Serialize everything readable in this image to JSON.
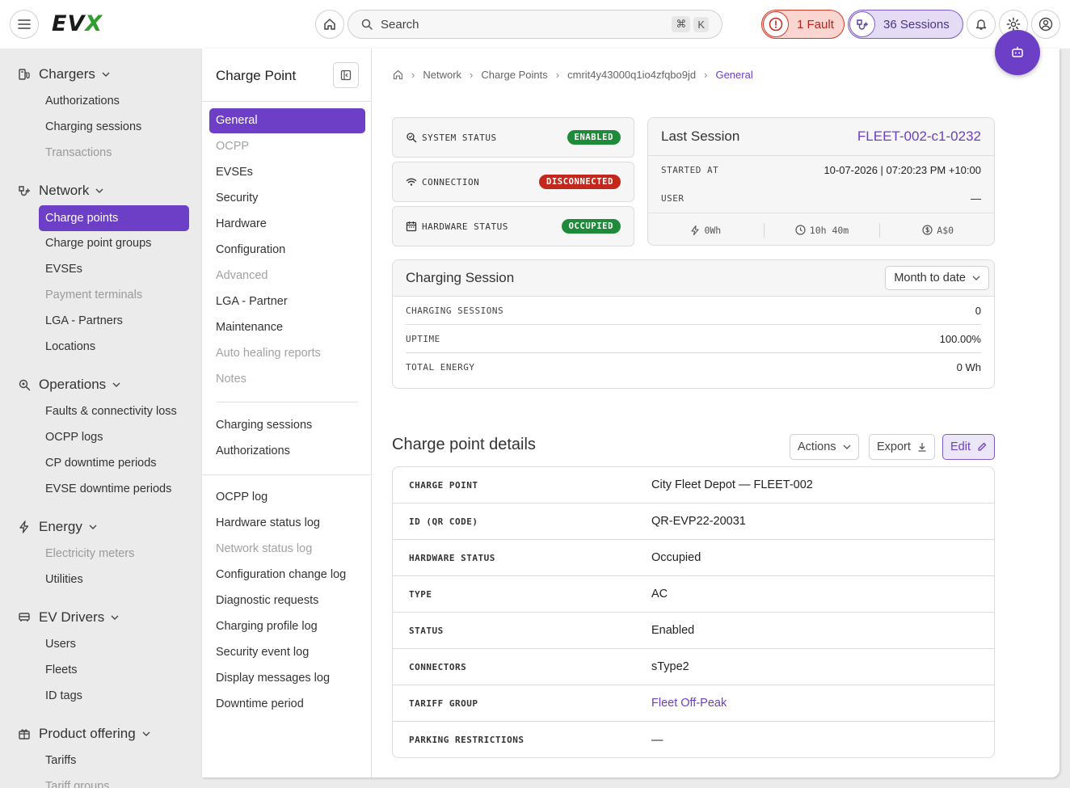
{
  "brand": {
    "logo_e": "EV",
    "logo_x": "X"
  },
  "search": {
    "label": "Search",
    "key1": "⌘",
    "key2": "K"
  },
  "header": {
    "fault_label": "1 Fault",
    "sessions_label": "36 Sessions"
  },
  "colors": {
    "accent": "#6c3fc6",
    "success": "#1f8a3a",
    "danger": "#c4271c"
  },
  "leftnav": {
    "chargers": {
      "label": "Chargers",
      "items": [
        "Authorizations",
        "Charging sessions",
        "Transactions"
      ]
    },
    "network": {
      "label": "Network",
      "items": [
        "Charge points",
        "Charge point groups",
        "EVSEs",
        "Payment terminals",
        "LGA - Partners",
        "Locations"
      ]
    },
    "operations": {
      "label": "Operations",
      "items": [
        "Faults & connectivity loss",
        "OCPP logs",
        "CP downtime periods",
        "EVSE downtime periods"
      ]
    },
    "energy": {
      "label": "Energy",
      "items": [
        "Electricity meters",
        "Utilities"
      ]
    },
    "drivers": {
      "label": "EV Drivers",
      "items": [
        "Users",
        "Fleets",
        "ID tags"
      ]
    },
    "product": {
      "label": "Product offering",
      "items": [
        "Tariffs",
        "Tariff groups"
      ]
    }
  },
  "subnav": {
    "title": "Charge Point",
    "group1": [
      "General",
      "OCPP",
      "EVSEs",
      "Security",
      "Hardware",
      "Configuration",
      "Advanced",
      "LGA - Partner",
      "Maintenance",
      "Auto healing reports",
      "Notes"
    ],
    "group2": [
      "Charging sessions",
      "Authorizations"
    ],
    "group3": [
      "OCPP log",
      "Hardware status log",
      "Network status log",
      "Configuration change log",
      "Diagnostic requests",
      "Charging profile log",
      "Security event log",
      "Display messages log",
      "Downtime period"
    ]
  },
  "breadcrumb": [
    "Network",
    "Charge Points",
    "cmrit4y43000q1io4zfqbo9jd",
    "General"
  ],
  "status": {
    "system": {
      "label": "SYSTEM STATUS",
      "badge": "ENABLED"
    },
    "connection": {
      "label": "CONNECTION",
      "badge": "DISCONNECTED"
    },
    "hardware": {
      "label": "HARDWARE STATUS",
      "badge": "OCCUPIED"
    }
  },
  "last_session": {
    "title": "Last Session",
    "id": "FLEET-002-c1-0232",
    "started_label": "STARTED AT",
    "started_value": "10-07-2026 | 07:20:23 PM +10:00",
    "user_label": "USER",
    "user_value": "—",
    "energy": "0Wh",
    "duration": "10h 40m",
    "cost": "A$0"
  },
  "charging_session": {
    "title": "Charging Session",
    "period": "Month to date",
    "rows": [
      {
        "label": "CHARGING SESSIONS",
        "value": "0"
      },
      {
        "label": "UPTIME",
        "value": "100.00%"
      },
      {
        "label": "TOTAL ENERGY",
        "value": "0 Wh"
      }
    ]
  },
  "details": {
    "title": "Charge point details",
    "actions_label": "Actions",
    "export_label": "Export",
    "edit_label": "Edit",
    "rows": [
      {
        "label": "CHARGE POINT",
        "value": "City Fleet Depot — FLEET-002"
      },
      {
        "label": "ID (QR CODE)",
        "value": "QR-EVP22-20031"
      },
      {
        "label": "HARDWARE STATUS",
        "value": "Occupied"
      },
      {
        "label": "TYPE",
        "value": "AC"
      },
      {
        "label": "STATUS",
        "value": "Enabled"
      },
      {
        "label": "CONNECTORS",
        "value": "sType2"
      },
      {
        "label": "TARIFF GROUP",
        "value": "Fleet Off-Peak"
      },
      {
        "label": "PARKING RESTRICTIONS",
        "value": "—"
      }
    ]
  }
}
